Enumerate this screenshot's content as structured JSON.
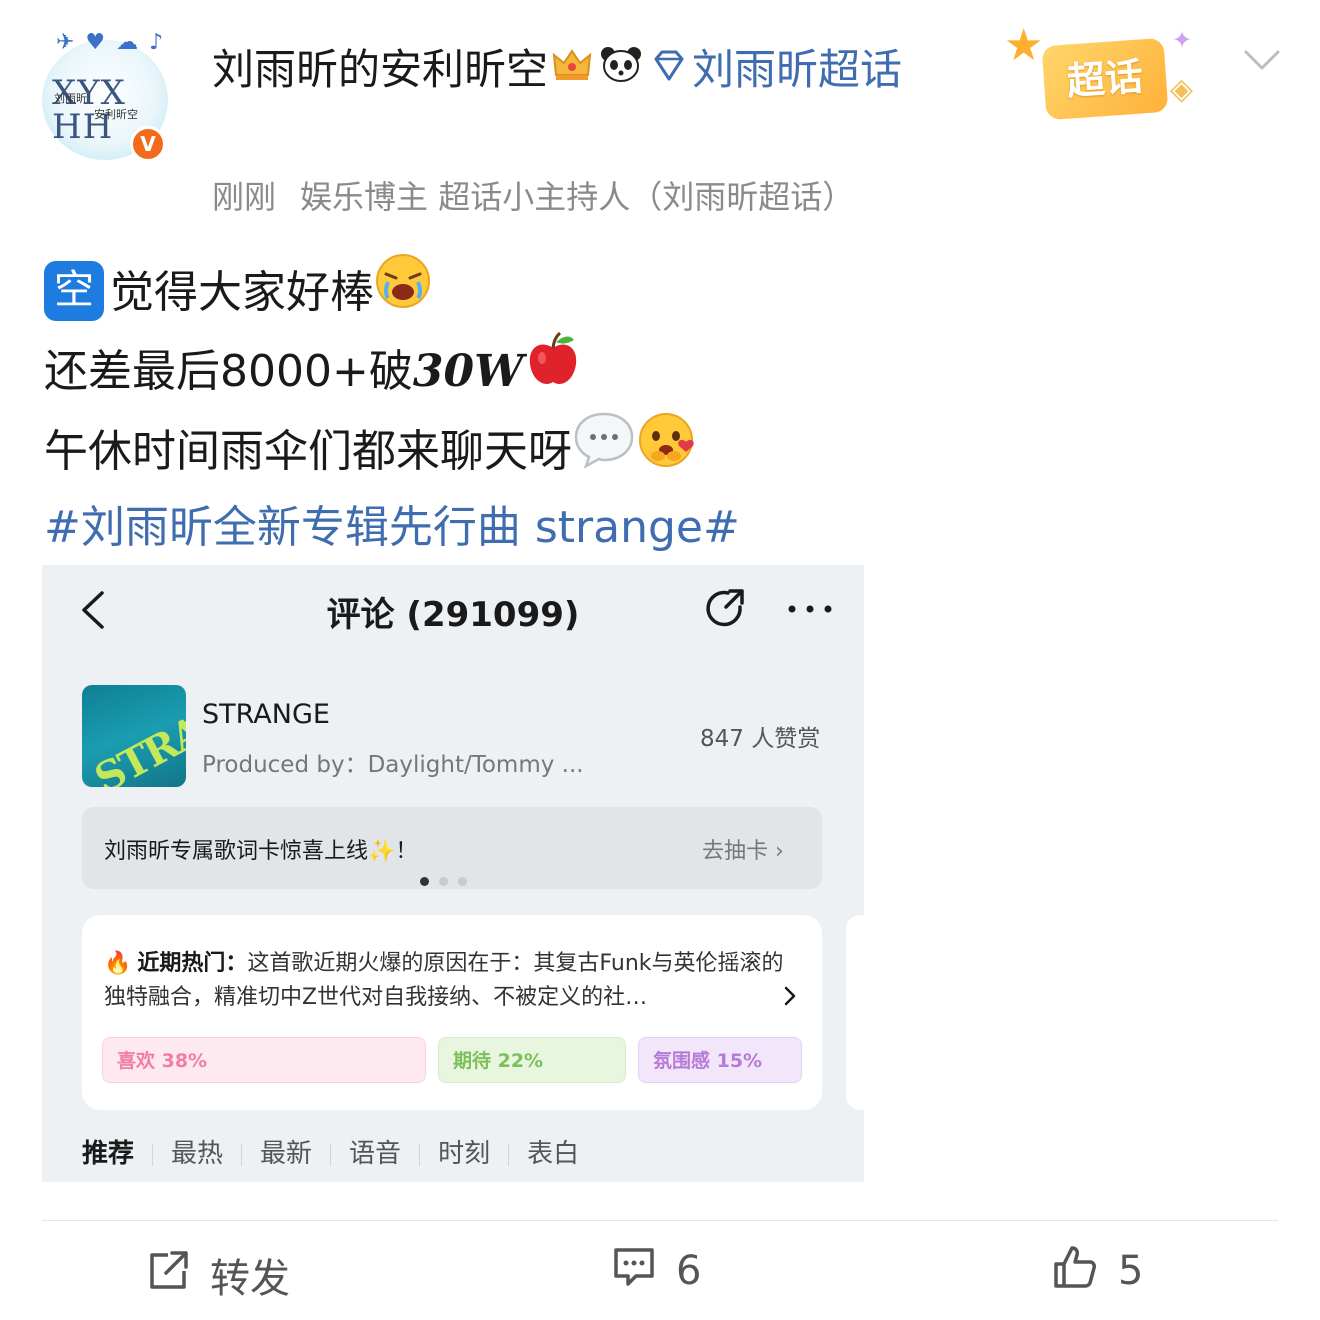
{
  "header": {
    "username": "刘雨昕的安利昕空",
    "supertopic_label": "刘雨昕超话",
    "time": "刚刚",
    "tags": "娱乐博主 超话小主持人（刘雨昕超话）",
    "badge_label": "超话",
    "verified_mark": "V",
    "avatar_text": {
      "line1": "XYX HH",
      "line2": "刘雨昕",
      "line3": "安利昕空"
    }
  },
  "post": {
    "line1_prefix_icon": "空",
    "line1": "觉得大家好棒",
    "line2_text": "还差最后8000+破",
    "line2_bold": "30W",
    "line3": "午休时间雨伞们都来聊天呀",
    "hashtag": "#刘雨昕全新专辑先行曲 strange#"
  },
  "embedded": {
    "title": "评论 (291099)",
    "song": {
      "title": "STRANGE",
      "producer": "Produced by：Daylight/Tommy ...",
      "likes": "847 人赞赏",
      "cover_text": "STRANGE"
    },
    "banner": {
      "text": "刘雨昕专属歌词卡惊喜上线",
      "text_suffix": "！",
      "cta": "去抽卡 ›",
      "dot_count": 3,
      "active_dot": 0
    },
    "hot": {
      "label": "近期热门：",
      "text": "这首歌近期火爆的原因在于：其复古Funk与英伦摇滚的独特融合，精准切中Z世代对自我接纳、不被定义的社…",
      "chips": [
        {
          "label": "喜欢 38%",
          "value": 38
        },
        {
          "label": "期待 22%",
          "value": 22
        },
        {
          "label": "氛围感 15%",
          "value": 15
        }
      ]
    },
    "tabs": [
      "推荐",
      "最热",
      "最新",
      "语音",
      "时刻",
      "表白"
    ],
    "active_tab": 0
  },
  "actions": {
    "repost_label": "转发",
    "comment_count": "6",
    "like_count": "5"
  },
  "colors": {
    "link_blue": "#3f6db0",
    "verified_orange": "#f26a1b",
    "kong_blue": "#1e7ce0"
  }
}
